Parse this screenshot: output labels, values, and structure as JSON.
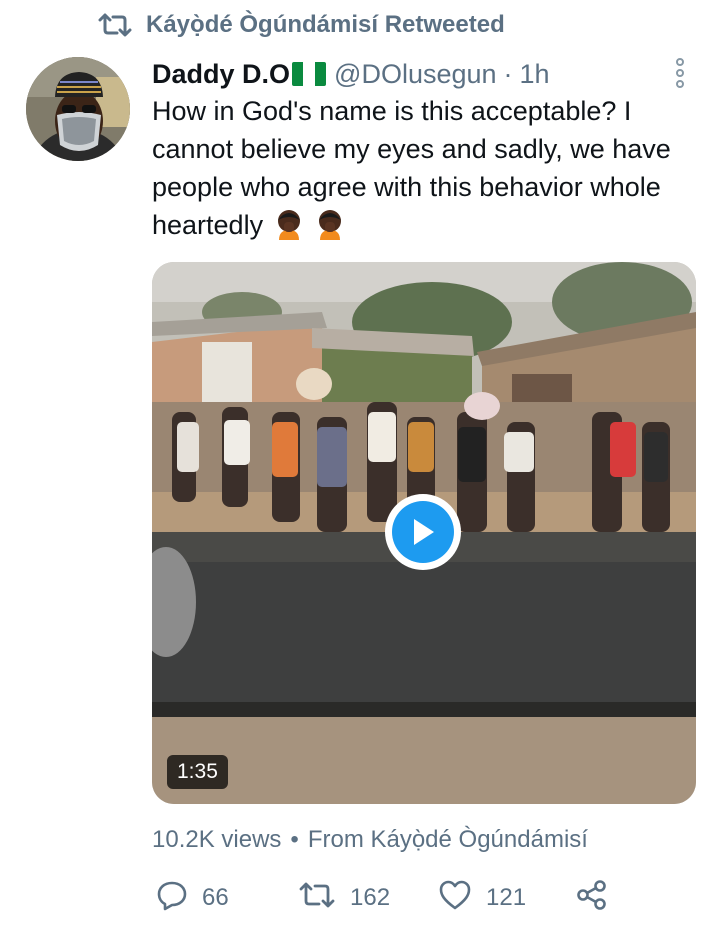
{
  "retweet": {
    "label": "Káyọ̀dé Ògúndámisí Retweeted",
    "icon": "retweet-icon"
  },
  "tweet": {
    "author_name": "Daddy D.O",
    "author_flag": "nigeria-flag-icon",
    "handle": "@DOlusegun",
    "separator": "·",
    "time": "1h",
    "text": "How in God's name is this acceptable? I cannot believe my eyes and sadly, we have people who agree with this behavior whole heartedly",
    "emojis": [
      "face-palm-emoji",
      "face-palm-emoji"
    ]
  },
  "media": {
    "type": "video",
    "duration": "1:35",
    "play_icon": "play-icon"
  },
  "meta": {
    "views": "10.2K views",
    "separator": "•",
    "source": "From Káyọ̀dé Ògúndámisí"
  },
  "actions": {
    "replies": "66",
    "retweets": "162",
    "likes": "121",
    "share_icon": "share-icon"
  },
  "colors": {
    "text": "#0f1419",
    "secondary": "#5b7083",
    "accent": "#1d9bf0"
  }
}
